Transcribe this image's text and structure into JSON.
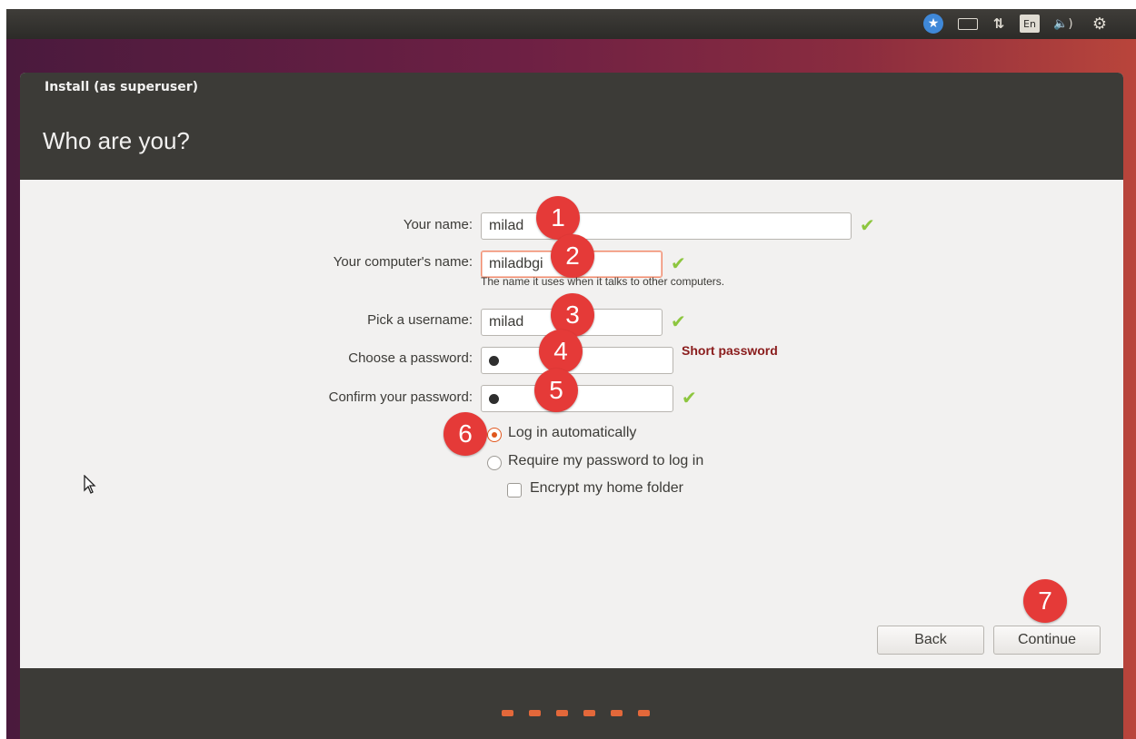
{
  "window": {
    "title": "Install (as superuser)",
    "heading": "Who are you?"
  },
  "topbar": {
    "accessibility_icon": "accessibility-icon",
    "keyboard_icon": "keyboard-icon",
    "network_icon": "network-icon",
    "language": "En",
    "volume_icon": "volume-icon",
    "power_icon": "power-icon"
  },
  "form": {
    "name_label": "Your name:",
    "name_value": "milad",
    "computer_label": "Your computer's name:",
    "computer_value": "miladbgi",
    "computer_hint": "The name it uses when it talks to other computers.",
    "username_label": "Pick a username:",
    "username_value": "milad",
    "password_label": "Choose a password:",
    "password_strength": "Short password",
    "confirm_label": "Confirm your password:",
    "login_auto": "Log in automatically",
    "login_require": "Require my password to log in",
    "encrypt": "Encrypt my home folder"
  },
  "buttons": {
    "back": "Back",
    "continue": "Continue"
  },
  "badges": [
    "1",
    "2",
    "3",
    "4",
    "5",
    "6",
    "7"
  ],
  "progress": {
    "steps_shown": 6
  },
  "colors": {
    "accent": "#e0571e",
    "valid": "#8dc63f",
    "badge": "#e53a38",
    "warning": "#8a1c1c"
  }
}
